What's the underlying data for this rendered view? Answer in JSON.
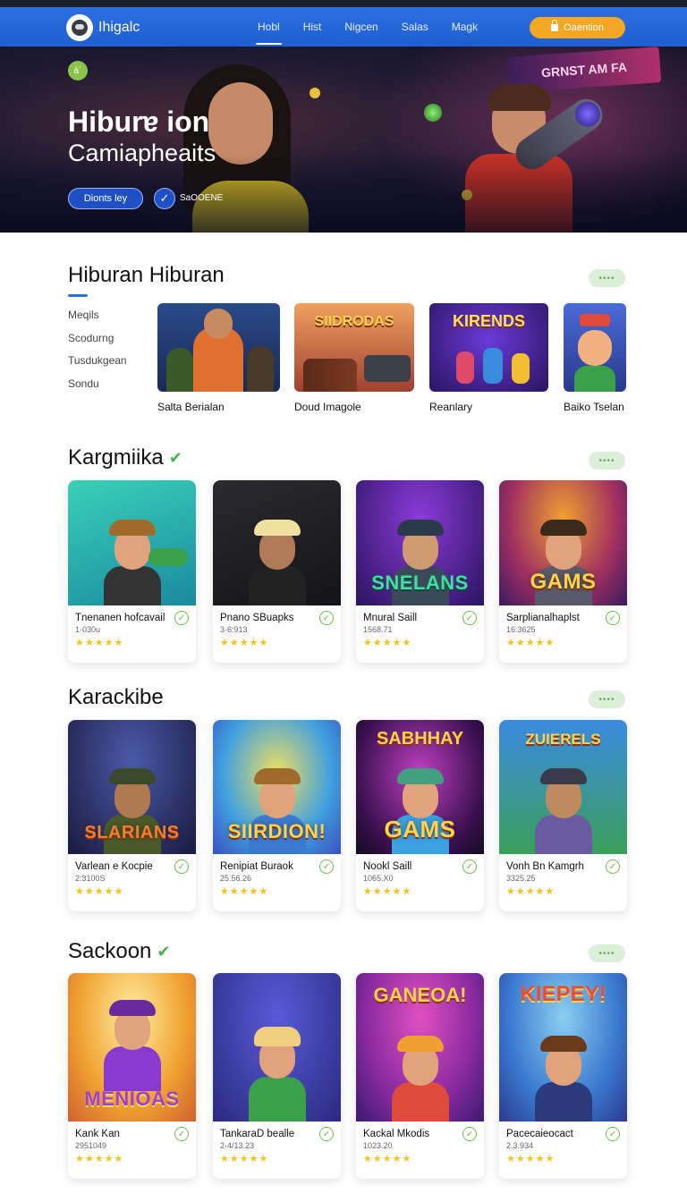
{
  "header": {
    "brand": "Ihigalc",
    "nav": [
      "Hobl",
      "Hist",
      "Nigcen",
      "Salas",
      "Magk"
    ],
    "active_nav": "Hobl",
    "cta_label": "Oaention"
  },
  "hero": {
    "badge": "à´",
    "title": "Hiburɐ ion",
    "subtitle": "Camiapheaits",
    "primary_button": "Dionts ley",
    "check_label": "SaOOENE",
    "neon_sign": "GRNST AM FA"
  },
  "featured": {
    "title": "Hiburan Hiburan",
    "more": "••••",
    "menu": [
      "Meqils",
      "Scodurng",
      "Tusdukgean",
      "Sondu"
    ],
    "items": [
      {
        "caption": "Salta Berialan",
        "art_text": ""
      },
      {
        "caption": "Doud Imagole",
        "art_text": "SIIDRODAS"
      },
      {
        "caption": "Reanlary",
        "art_text": "KIRENDS"
      },
      {
        "caption": "Baiko Tselan",
        "art_text": ""
      }
    ]
  },
  "sections": [
    {
      "title": "Kargmiika",
      "verified": true,
      "more": "••••",
      "cards": [
        {
          "name": "Tnenanen hofcavail",
          "num": "1·030u",
          "stars": "★★★★★",
          "art_text": ""
        },
        {
          "name": "Pnano SBuapks",
          "num": "3·6:913",
          "stars": "★★★★★",
          "art_text": ""
        },
        {
          "name": "Mnural Saill",
          "num": "1568.71",
          "stars": "★★★★★",
          "art_text": "SNELANS"
        },
        {
          "name": "Sarplianalhaplst",
          "num": "16:3625",
          "stars": "★★★★★",
          "art_text": "GAMS"
        }
      ]
    },
    {
      "title": "Karackibe",
      "verified": false,
      "more": "••••",
      "cards": [
        {
          "name": "Varlean e Kocpie",
          "num": "2:3100S",
          "stars": "★★★★★",
          "art_text": "SLARIANS"
        },
        {
          "name": "Renipiat Buraok",
          "num": "25.56.26",
          "stars": "★★★★★",
          "art_text": "SIIRDION!"
        },
        {
          "name": "Nookl Saill",
          "num": "1065.X0",
          "stars": "★★★★★",
          "art_text": "GAMS"
        },
        {
          "name": "Vonh Bn Kamgrh",
          "num": "3325.25",
          "stars": "★★★★★",
          "art_text": "ZUIERELS"
        }
      ]
    },
    {
      "title": "Sackoon",
      "verified": true,
      "more": "••••",
      "cards": [
        {
          "name": "Kank Kan",
          "num": "2951049",
          "stars": "★★★★★",
          "art_text": "MENIOAS"
        },
        {
          "name": "TankaraD bealle",
          "num": "2·4/13.23",
          "stars": "★★★★★",
          "art_text": ""
        },
        {
          "name": "Kackal Mkodis",
          "num": "1023.20",
          "stars": "★★★★★",
          "art_text": "GANEOA!"
        },
        {
          "name": "Pacecaieocact",
          "num": "2.3.934",
          "stars": "★★★★★",
          "art_text": "KIEPEY!"
        }
      ]
    }
  ],
  "colors": {
    "accent_blue": "#2c6fe0",
    "cta_orange": "#f5a623",
    "verified_green": "#4caf50",
    "star_yellow": "#f2c318"
  }
}
